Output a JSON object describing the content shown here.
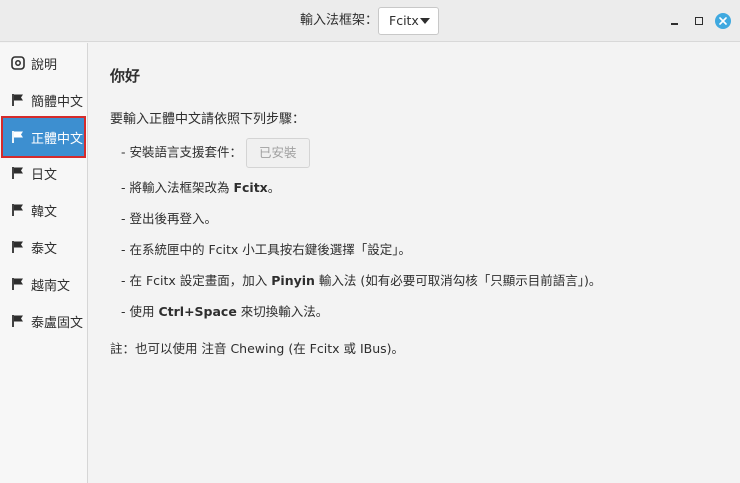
{
  "titlebar": {
    "framework_label": "輸入法框架：",
    "framework_value": "Fcitx"
  },
  "sidebar": {
    "items": [
      {
        "label": "說明",
        "icon": "help-icon"
      },
      {
        "label": "簡體中文",
        "icon": "flag-icon"
      },
      {
        "label": "正體中文",
        "icon": "flag-icon",
        "selected": true
      },
      {
        "label": "日文",
        "icon": "flag-icon"
      },
      {
        "label": "韓文",
        "icon": "flag-icon"
      },
      {
        "label": "泰文",
        "icon": "flag-icon"
      },
      {
        "label": "越南文",
        "icon": "flag-icon"
      },
      {
        "label": "泰盧固文",
        "icon": "flag-icon"
      }
    ]
  },
  "content": {
    "heading": "你好",
    "intro": "要輸入正體中文請依照下列步驟：",
    "steps": {
      "s1_text": "- 安裝語言支援套件：",
      "s1_button": "已安裝",
      "s2_pre": "- 將輸入法框架改為 ",
      "s2_bold": "Fcitx",
      "s2_post": "。",
      "s3": "- 登出後再登入。",
      "s4": "- 在系統匣中的 Fcitx 小工具按右鍵後選擇「設定」。",
      "s5_pre": "- 在 Fcitx 設定畫面，加入 ",
      "s5_bold": "Pinyin",
      "s5_post": " 輸入法 (如有必要可取消勾核「只顯示目前語言」)。",
      "s6_pre": "- 使用 ",
      "s6_bold": "Ctrl+Space",
      "s6_post": " 來切換輸入法。"
    },
    "note": "註：也可以使用 注音 Chewing (在 Fcitx 或 IBus)。"
  },
  "colors": {
    "selected_bg": "#3d8fd0",
    "selected_outline": "#d52b2b",
    "close_button": "#3fa9e0"
  }
}
